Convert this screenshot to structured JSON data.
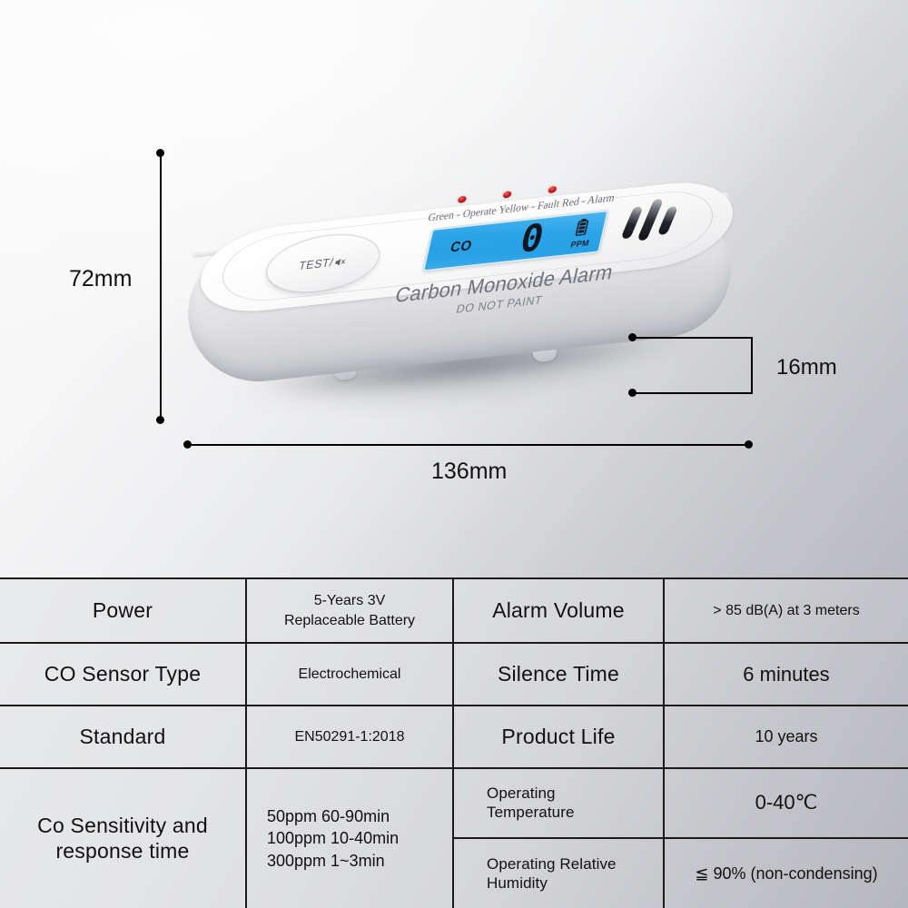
{
  "product": {
    "button_label": "TEST/",
    "button_icon": "mute-speaker-icon",
    "legend": "Green - Operate  Yellow - Fault  Red - Alarm",
    "lcd": {
      "gas_label": "CO",
      "value": "0",
      "unit": "PPM",
      "battery_icon": "battery-full-icon",
      "backlight_color": "#2ba3e8"
    },
    "brand_text": "Carbon Monoxide Alarm",
    "warning_text": "DO NOT PAINT",
    "led_count": 3,
    "led_color": "#d92f2f",
    "vent_count": 3
  },
  "dimensions": {
    "height": "72mm",
    "width": "136mm",
    "depth": "16mm"
  },
  "spec_table": {
    "rows": [
      {
        "key1": "Power",
        "val1": "5-Years 3V\nReplaceable Battery",
        "key2": "Alarm Volume",
        "val2": "> 85 dB(A) at 3 meters"
      },
      {
        "key1": "CO Sensor Type",
        "val1": "Electrochemical",
        "key2": "Silence Time",
        "val2": "6 minutes"
      },
      {
        "key1": "Standard",
        "val1": "EN50291-1:2018",
        "key2": "Product Life",
        "val2": "10 years"
      }
    ],
    "last_row": {
      "key1": "Co Sensitivity and\nresponse time",
      "val1": "50ppm 60-90min\n100ppm 10-40min\n300ppm 1~3min",
      "sub": [
        {
          "key": "Operating\nTemperature",
          "val": "0-40℃"
        },
        {
          "key": "Operating Relative\nHumidity",
          "val": "≦ 90% (non-condensing)"
        }
      ]
    }
  }
}
